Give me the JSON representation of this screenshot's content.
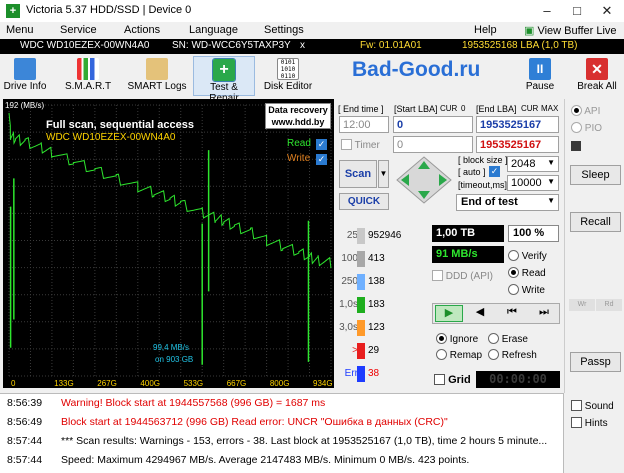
{
  "window": {
    "title": "Victoria 5.37 HDD/SSD | Device 0"
  },
  "menu": {
    "items": [
      "Menu",
      "Service",
      "Actions",
      "Language",
      "Settings",
      "Help"
    ],
    "view_buffer_live": "View Buffer Live"
  },
  "drive_bar": {
    "model": "WDC WD10EZEX-00WN4A0",
    "serial": "SN: WD-WCC6Y5TAXP3Y",
    "close": "x",
    "firmware": "Fw: 01.01A01",
    "lba": "1953525168 LBA (1,0 TB)"
  },
  "toolbar": {
    "buttons": [
      {
        "label": "Drive Info",
        "icon": "drive-info-icon"
      },
      {
        "label": "S.M.A.R.T",
        "icon": "smart-icon"
      },
      {
        "label": "SMART Logs",
        "icon": "smart-logs-icon"
      },
      {
        "label": "Test & Repair",
        "icon": "test-repair-icon"
      },
      {
        "label": "Disk Editor",
        "icon": "disk-editor-icon"
      }
    ],
    "brand": "Bad-Good.ru",
    "pause_label": "Pause",
    "break_label": "Break All"
  },
  "graph": {
    "y_top_label": "192 (MB/s)",
    "title": "Full scan, sequential access",
    "drive": "WDC WD10EZEX-00WN4A0",
    "watermark_line1": "Data recovery",
    "watermark_line2": "www.hdd.by",
    "read_label": "Read",
    "write_label": "Write",
    "speed_note": "99,4 MB/s",
    "on_note": "on 903 GB",
    "x_ticks": [
      "0",
      "133G",
      "267G",
      "400G",
      "533G",
      "667G",
      "800G",
      "934G"
    ],
    "colors": {
      "read": "#2ee62e",
      "write": "#e08020",
      "grid": "#3a3a3a"
    }
  },
  "chart_data": {
    "type": "line",
    "title": "Full scan, sequential access",
    "xlabel": "",
    "ylabel": "(MB/s)",
    "x_unit": "GB",
    "xlim": [
      0,
      1000
    ],
    "ylim": [
      0,
      192
    ],
    "series": [
      {
        "name": "Read",
        "x": [
          0,
          5,
          20,
          50,
          100,
          133,
          200,
          267,
          333,
          400,
          450,
          500,
          533,
          600,
          640,
          667,
          700,
          750,
          800,
          850,
          900,
          934,
          960,
          1000
        ],
        "values": [
          190,
          170,
          168,
          166,
          162,
          158,
          152,
          146,
          140,
          134,
          130,
          126,
          122,
          116,
          112,
          110,
          106,
          102,
          96,
          92,
          88,
          84,
          82,
          80
        ]
      }
    ]
  },
  "lba_panel": {
    "end_time_label": "End time",
    "start_lba_label": "Start LBA",
    "cur": "CUR",
    "zero": "0",
    "end_lba_label": "End LBA",
    "max": "MAX",
    "time_value": "12:00",
    "start_lba_value": "0",
    "end_lba_value": "1953525167",
    "timer_label": "Timer",
    "timer_value": "0",
    "current_lba_value": "1953525167",
    "block_size_label": "block size",
    "auto_label": "auto",
    "block_size_value": "2048",
    "timeout_label": "timeout,ms",
    "timeout_value": "10000",
    "scan_label": "Scan",
    "quick_label": "QUICK",
    "end_of_test_label": "End of test"
  },
  "counters": {
    "items": [
      {
        "label": "25",
        "value": "952946",
        "color": "#c8c8c8"
      },
      {
        "label": "100",
        "value": "413",
        "color": "#a8a8a8"
      },
      {
        "label": "250",
        "value": "138",
        "color": "#6fb0ff"
      },
      {
        "label": "1,0s",
        "value": "183",
        "color": "#1eae1e"
      },
      {
        "label": "3,0s",
        "value": "123",
        "color": "#ff9a2a"
      },
      {
        "label": ">",
        "value": "29",
        "color": "#e81e1e"
      },
      {
        "label": "Err",
        "value": "38",
        "color": "#1e3cff"
      }
    ],
    "err_mark": "x"
  },
  "progress": {
    "size": "1,00 TB",
    "percent": "100",
    "percent_sign": "%",
    "speed": "91 MB/s",
    "ddd_label": "DDD (API)",
    "verify_label": "Verify",
    "read_label": "Read",
    "write_label": "Write"
  },
  "actions": {
    "ignore_label": "Ignore",
    "erase_label": "Erase",
    "remap_label": "Remap",
    "refresh_label": "Refresh",
    "grid_label": "Grid",
    "clock": "00:00:00"
  },
  "side": {
    "api_label": "API",
    "pio_label": "PIO",
    "sleep_label": "Sleep",
    "recall_label": "Recall",
    "wr_label": "Wr",
    "rd_label": "Rd",
    "passp_label": "Passp",
    "sound_label": "Sound",
    "hints_label": "Hints"
  },
  "log": {
    "rows": [
      {
        "time": "8:56:39",
        "msg": "Warning! Block start at 1944557568 (996 GB)  = 1687 ms",
        "color": "#e00000"
      },
      {
        "time": "8:56:49",
        "msg": "Block start at 1944563712 (996 GB) Read error: UNCR \"Ошибка в данных (CRC)\"",
        "color": "#e00000"
      },
      {
        "time": "8:57:44",
        "msg": "*** Scan results: Warnings - 153, errors - 38. Last block at 1953525167 (1,0 TB), time 2 hours 5 minute...",
        "color": "#000000"
      },
      {
        "time": "8:57:44",
        "msg": "Speed: Maximum 4294967 MB/s. Average 2147483 MB/s. Minimum 0 MB/s. 423 points.",
        "color": "#000000"
      }
    ]
  }
}
